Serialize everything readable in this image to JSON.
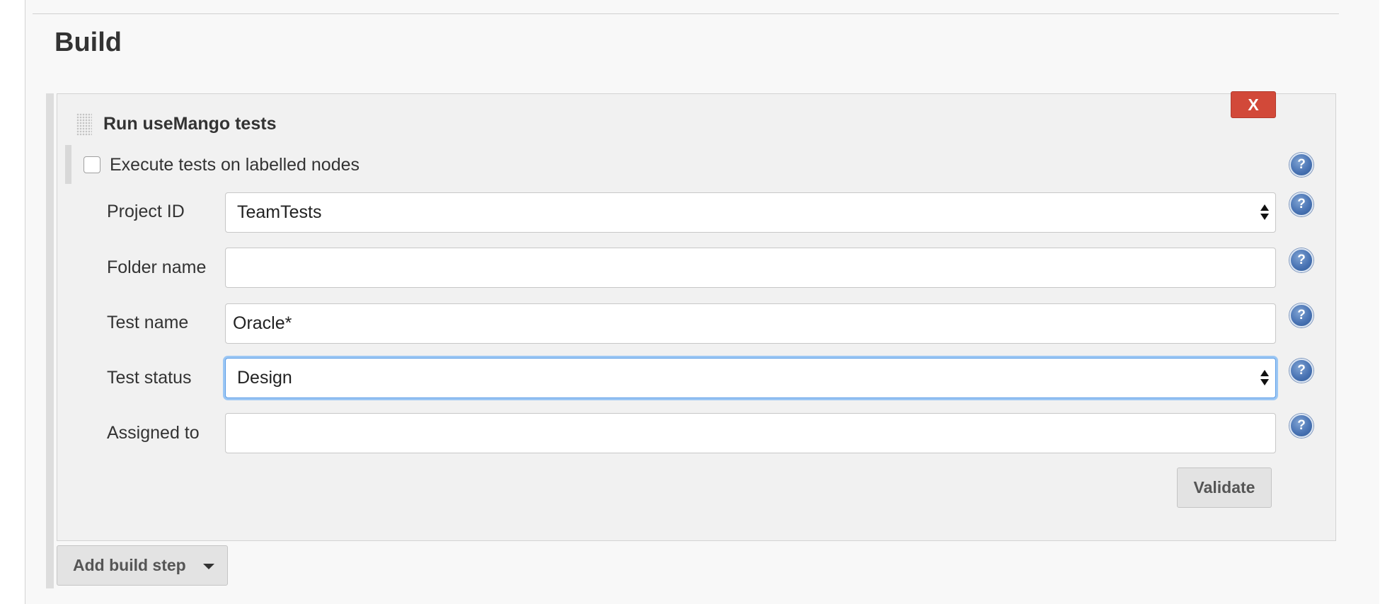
{
  "section": {
    "title": "Build"
  },
  "build_step": {
    "title": "Run useMango tests",
    "delete_label": "X",
    "labelled_nodes_checkbox": {
      "label": "Execute tests on labelled nodes",
      "checked": false
    },
    "fields": {
      "project_id": {
        "label": "Project ID",
        "value": "TeamTests"
      },
      "folder_name": {
        "label": "Folder name",
        "value": ""
      },
      "test_name": {
        "label": "Test name",
        "value": "Oracle*"
      },
      "test_status": {
        "label": "Test status",
        "value": "Design"
      },
      "assigned_to": {
        "label": "Assigned to",
        "value": ""
      }
    },
    "help_glyph": "?",
    "validate_label": "Validate"
  },
  "add_build_step_label": "Add build step",
  "icons": {
    "drag": "drag-handle-icon",
    "help": "help-icon",
    "select": "select-arrows-icon",
    "dropdown": "caret-down-icon"
  },
  "colors": {
    "delete_button": "#d24939",
    "focus_ring": "#9cc7f4",
    "help_icon": "#4a74b4"
  }
}
